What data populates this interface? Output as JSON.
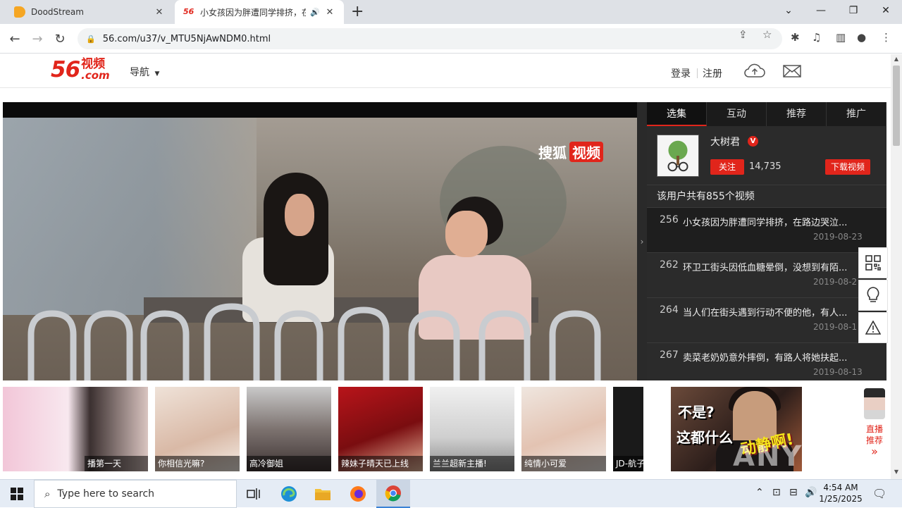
{
  "browser": {
    "tabs": [
      {
        "title": "DoodStream",
        "active": false
      },
      {
        "title": "小女孩因为胖遭同学排挤，在路边哭泣…",
        "active": true
      }
    ],
    "url": "56.com/u37/v_MTU5NjAwNDM0.html",
    "new_tab": "+"
  },
  "site": {
    "logo_number": "56",
    "logo_text": "视频",
    "logo_domain": ".com",
    "nav_menu": "导航",
    "login": "登录",
    "register": "注册"
  },
  "player": {
    "watermark_brand": "搜狐",
    "watermark_tag": "视频",
    "collapse_arrow": "›"
  },
  "sidepanel": {
    "tabs": [
      "选集",
      "互动",
      "推荐",
      "推广"
    ],
    "uploader_name": "大树君",
    "verified_badge": "V",
    "follow_label": "关注",
    "follower_count": "14,735",
    "download_label": "下载视频",
    "video_count_text": "该用户共有855个视频",
    "videos": [
      {
        "num": "256",
        "title": "小女孩因为胖遭同学排挤，在路边哭泣...",
        "date": "2019-08-23",
        "active": true
      },
      {
        "num": "262",
        "title": "环卫工街头因低血糖晕倒，没想到有陌...",
        "date": "2019-08-2",
        "active": false
      },
      {
        "num": "264",
        "title": "当人们在街头遇到行动不便的他，有人...",
        "date": "2019-08-1",
        "active": false
      },
      {
        "num": "267",
        "title": "卖菜老奶奶意外摔倒，有路人将她扶起...",
        "date": "2019-08-13",
        "active": false
      }
    ]
  },
  "recommendations": [
    {
      "caption": "播第一天"
    },
    {
      "caption": "你相信光嘛?"
    },
    {
      "caption": "高冷御姐"
    },
    {
      "caption": "辣妹子晴天已上线"
    },
    {
      "caption": "兰兰超新主播!"
    },
    {
      "caption": "纯情小可爱"
    },
    {
      "caption": "JD-航子"
    }
  ],
  "ad": {
    "line1": "不是?",
    "line2": "这都什么",
    "line3": "动静啊!"
  },
  "live_recommend": {
    "line1": "直播",
    "line2": "推荐",
    "arrow": "»"
  },
  "overlay_watermark": "ANY RUN",
  "taskbar": {
    "search_placeholder": "Type here to search",
    "time": "4:54 AM",
    "date": "1/25/2025"
  },
  "colors": {
    "brand_red": "#e1251b",
    "panel_dark": "#2b2b2b"
  }
}
